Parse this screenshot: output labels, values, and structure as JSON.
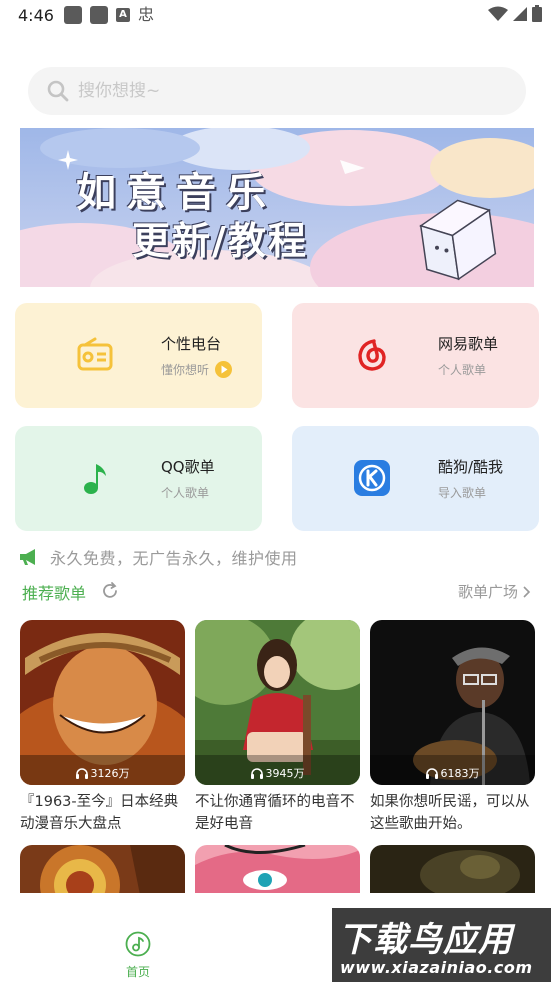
{
  "status_bar": {
    "time": "4:46",
    "a_badge": "A",
    "ime": "忠"
  },
  "search": {
    "placeholder": "搜你想搜~"
  },
  "banner": {
    "line1": "如意音乐",
    "line2": "更新/教程"
  },
  "cards": [
    {
      "title": "个性电台",
      "subtitle": "懂你想听",
      "icon": "radio-icon",
      "bg": "#fdf2d4"
    },
    {
      "title": "网易歌单",
      "subtitle": "个人歌单",
      "icon": "netease-icon",
      "bg": "#fbe3e3"
    },
    {
      "title": "QQ歌单",
      "subtitle": "个人歌单",
      "icon": "qq-music-icon",
      "bg": "#e3f5e9"
    },
    {
      "title": "酷狗/酷我",
      "subtitle": "导入歌单",
      "icon": "kugou-icon",
      "bg": "#e3eefa"
    }
  ],
  "notice": {
    "text": "永久免费，无广告永久，维护使用",
    "icon": "megaphone-icon"
  },
  "section": {
    "title": "推荐歌单",
    "more": "歌单广场"
  },
  "playlists": [
    {
      "count": "3126万",
      "desc": "『1963-至今』日本经典动漫音乐大盘点"
    },
    {
      "count": "3945万",
      "desc": "不让你通宵循环的电音不是好电音"
    },
    {
      "count": "6183万",
      "desc": "如果你想听民谣，可以从这些歌曲开始。"
    }
  ],
  "nav": {
    "home": "首页"
  },
  "watermark": {
    "main": "下载鸟应用",
    "url": "www.xiazainiao.com"
  },
  "colors": {
    "accent": "#4caf50",
    "radio": "#f5c23a",
    "netease": "#e02424",
    "qq": "#2bb24c",
    "kugou": "#2a7de1"
  }
}
